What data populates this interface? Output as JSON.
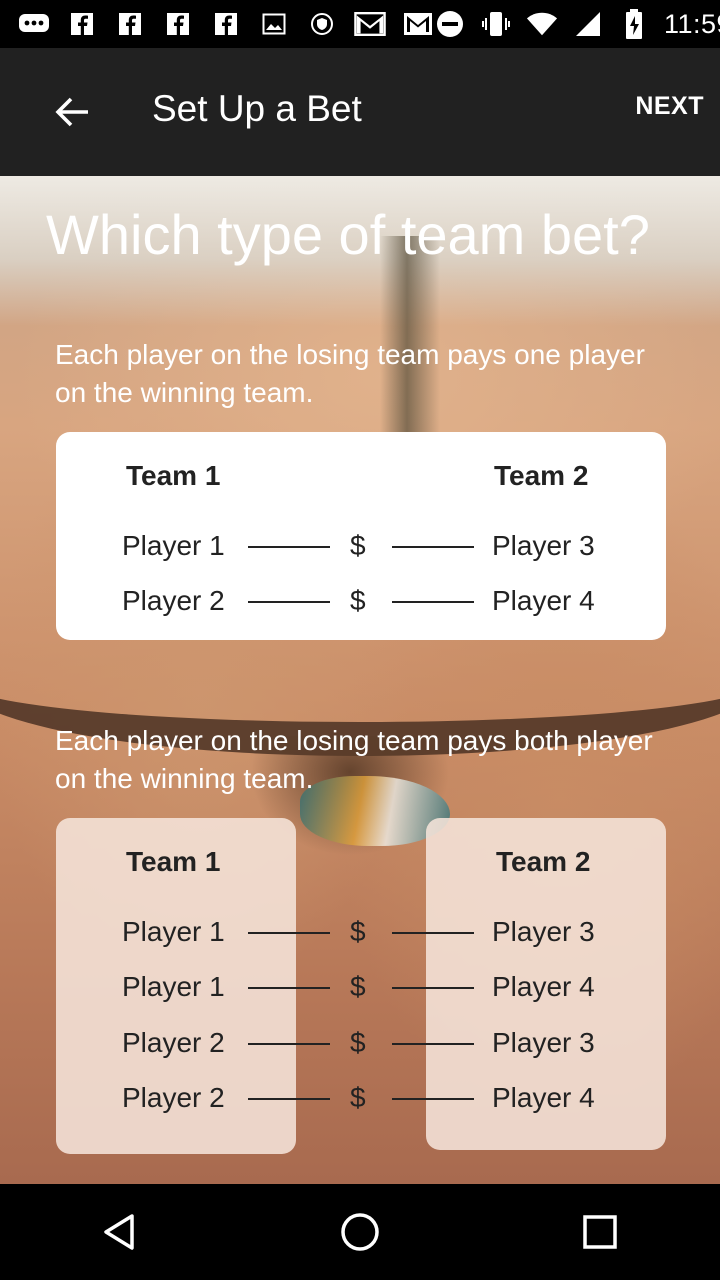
{
  "status_bar": {
    "time": "11:59",
    "left_icons": [
      "chat-icon",
      "facebook-icon",
      "facebook-icon",
      "facebook-icon",
      "facebook-icon",
      "image-icon",
      "shield-icon",
      "gmail-icon",
      "gmail-icon"
    ],
    "right_icons": [
      "do-not-disturb-icon",
      "vibrate-icon",
      "wifi-icon",
      "signal-icon",
      "battery-charging-icon"
    ]
  },
  "app_bar": {
    "title": "Set Up a Bet",
    "next_label": "NEXT",
    "background": "#212121"
  },
  "main": {
    "heading": "Which type of team bet?",
    "option_1": {
      "description": "Each player on the losing team pays one player on the winning team.",
      "team_1_label": "Team 1",
      "team_2_label": "Team 2",
      "rows": [
        {
          "left": "Player 1",
          "symbol": "$",
          "right": "Player 3"
        },
        {
          "left": "Player 2",
          "symbol": "$",
          "right": "Player 4"
        }
      ]
    },
    "option_2": {
      "description": "Each player on the losing team pays both player on the winning team.",
      "team_1_label": "Team 1",
      "team_2_label": "Team 2",
      "rows": [
        {
          "left": "Player 1",
          "symbol": "$",
          "right": "Player 3"
        },
        {
          "left": "Player 1",
          "symbol": "$",
          "right": "Player 4"
        },
        {
          "left": "Player 2",
          "symbol": "$",
          "right": "Player 3"
        },
        {
          "left": "Player 2",
          "symbol": "$",
          "right": "Player 4"
        }
      ]
    }
  },
  "nav_bar": {
    "icons": [
      "back-triangle-icon",
      "home-circle-icon",
      "recents-square-icon"
    ]
  }
}
